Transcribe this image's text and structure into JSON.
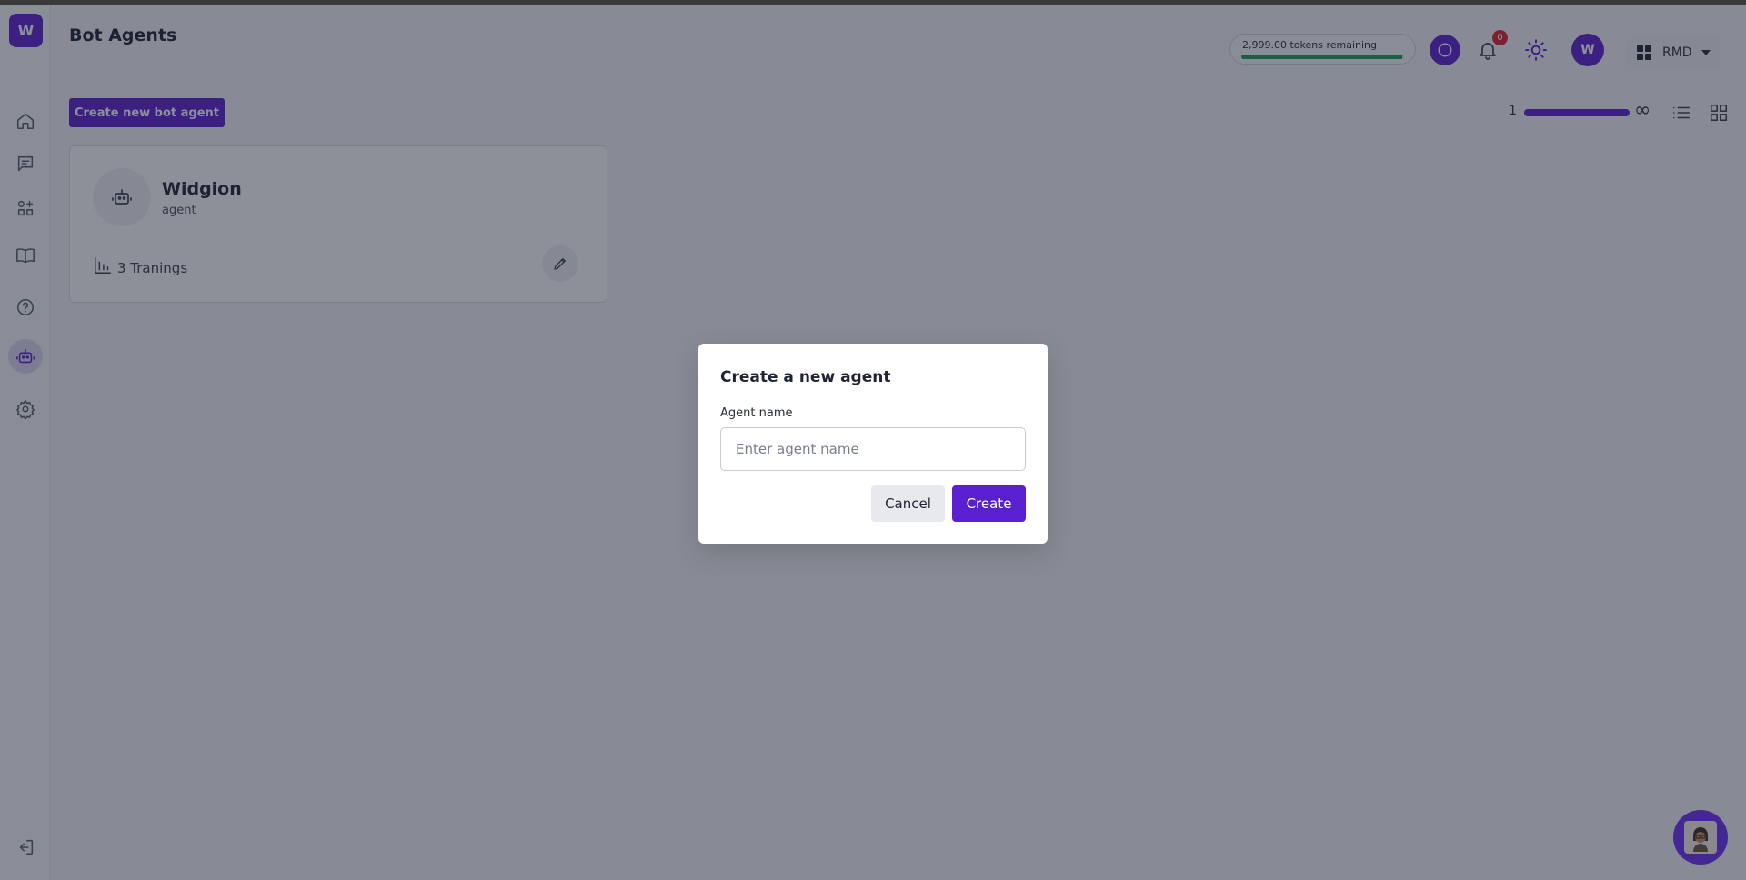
{
  "header": {
    "title": "Bot Agents",
    "tokens_label": "2,999.00 tokens remaining",
    "tokens_fraction": 0.99,
    "notification_count": "0",
    "avatar_initial": "W",
    "workspace_label": "RMD",
    "logo_initial": "W"
  },
  "sidebar": {
    "items": [
      {
        "name": "home",
        "icon": "home-icon"
      },
      {
        "name": "chat",
        "icon": "chat-icon"
      },
      {
        "name": "apps",
        "icon": "apps-icon"
      },
      {
        "name": "library",
        "icon": "book-icon"
      },
      {
        "name": "help",
        "icon": "help-icon"
      },
      {
        "name": "bot-agents",
        "icon": "robot-icon",
        "active": true
      },
      {
        "name": "settings",
        "icon": "gear-icon"
      }
    ],
    "logout_icon": "logout-icon"
  },
  "toolbar": {
    "create_label": "Create new bot agent",
    "pager_number": "1",
    "pager_infinity": "∞"
  },
  "agents": [
    {
      "name": "Widgion",
      "type": "agent",
      "trainings": "3 Tranings"
    }
  ],
  "modal": {
    "title": "Create a new agent",
    "field_label": "Agent name",
    "placeholder": "Enter agent name",
    "value": "",
    "cancel_label": "Cancel",
    "create_label": "Create"
  },
  "colors": {
    "brand": "#5a1fd1",
    "token_bar": "#12a150",
    "badge": "#e11d2a"
  }
}
